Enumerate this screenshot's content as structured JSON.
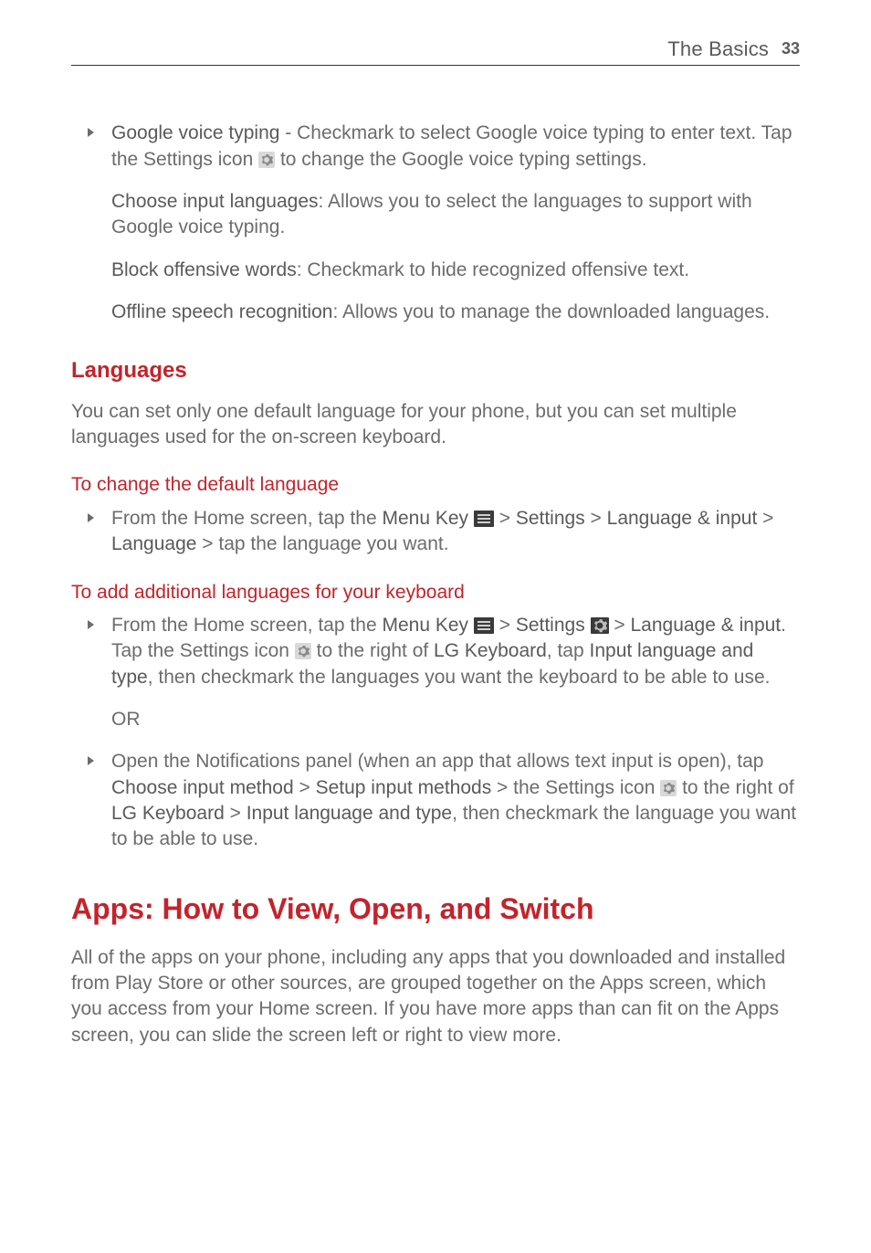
{
  "header": {
    "title": "The Basics",
    "page": "33"
  },
  "bullets": {
    "gvt": {
      "label": "Google voice typing",
      "pre": " - Checkmark to select Google voice typing to enter text. Tap the Settings icon ",
      "post": " to change the Google voice typing settings."
    },
    "cil": {
      "label": "Choose input languages",
      "rest": ": Allows you to select the languages to support with Google voice typing."
    },
    "bow": {
      "label": "Block offensive words",
      "rest": ": Checkmark to hide recognized offensive text."
    },
    "osr": {
      "label": "Offline speech recognition",
      "rest": ": Allows you to manage the downloaded languages."
    }
  },
  "languages": {
    "heading": "Languages",
    "intro": "You can set only one default language for your phone, but you can set multiple languages used for the on-screen keyboard.",
    "changeHeading": "To change the default language",
    "changeStep": {
      "pre": "From the Home screen, tap the ",
      "menuKey": "Menu Key",
      "gt1": " > ",
      "settings": "Settings",
      "gt2": " > ",
      "langInput": "Language & input",
      "gt3": " > ",
      "language": "Language",
      "post": " > tap the language you want."
    },
    "addHeading": "To add additional languages for your keyboard",
    "addStep1": {
      "pre": "From the Home screen, tap the ",
      "menuKey": "Menu Key",
      "gt1": " > ",
      "settings": "Settings",
      "gt2": " > ",
      "langInput": "Language & input",
      "tapSettingsPre": ". Tap the Settings icon ",
      "tapSettingsPost": " to the right of ",
      "lgk": "LG Keyboard",
      "then": ", tap ",
      "ilt": "Input language and type",
      "rest": ", then checkmark the languages you want the keyboard to be able to use."
    },
    "or": "OR",
    "addStep2": {
      "pre": "Open the Notifications panel (when an app that allows text input is open), tap ",
      "cim": "Choose input method",
      "gt1": " > ",
      "sim": "Setup input methods",
      "gt2": " > the Settings icon ",
      "post1": " to the right of ",
      "lgk": "LG Keyboard",
      "gt3": " > ",
      "ilt": "Input language and type",
      "rest": ", then checkmark the language you want to be able to use."
    }
  },
  "apps": {
    "heading": "Apps: How to View, Open, and Switch",
    "intro": "All of the apps on your phone, including any apps that you downloaded and installed from Play Store or other sources, are grouped together on the Apps screen, which you access from your Home screen. If you have more apps than can fit on the Apps screen, you can slide the screen left or right to view more."
  }
}
